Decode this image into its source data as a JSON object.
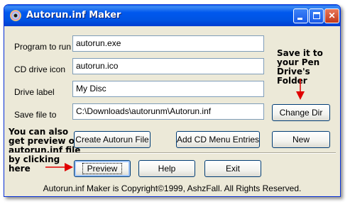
{
  "window": {
    "title": "Autorun.inf Maker",
    "controls": {
      "minimize": "_",
      "maximize": "□",
      "close": "✕"
    }
  },
  "fields": {
    "program": {
      "label": "Program to run",
      "value": "autorun.exe"
    },
    "icon": {
      "label": "CD drive icon",
      "value": "autorun.ico"
    },
    "drive_label": {
      "label": "Drive label",
      "value": "My Disc"
    },
    "save": {
      "label": "Save file to",
      "value": "C:\\Downloads\\autorunm\\Autorun.inf"
    }
  },
  "buttons": {
    "change_dir": "Change Dir",
    "create": "Create Autorun File",
    "add_menu": "Add CD Menu Entries",
    "new": "New",
    "preview": "Preview",
    "help": "Help",
    "exit": "Exit"
  },
  "annotations": {
    "save_hint": [
      "Save it to",
      "your Pen",
      "Drive's Folder"
    ],
    "preview_hint": [
      "You can also",
      "get preview of",
      "autorun.inf file",
      "by clicking",
      "here"
    ]
  },
  "footer": "Autorun.inf Maker is Copyright©1999, AshzFall.  All Rights Reserved.",
  "colors": {
    "annotation_arrow": "#e00000",
    "titlebar": "#0054e3",
    "window_bg": "#ece9d8"
  }
}
